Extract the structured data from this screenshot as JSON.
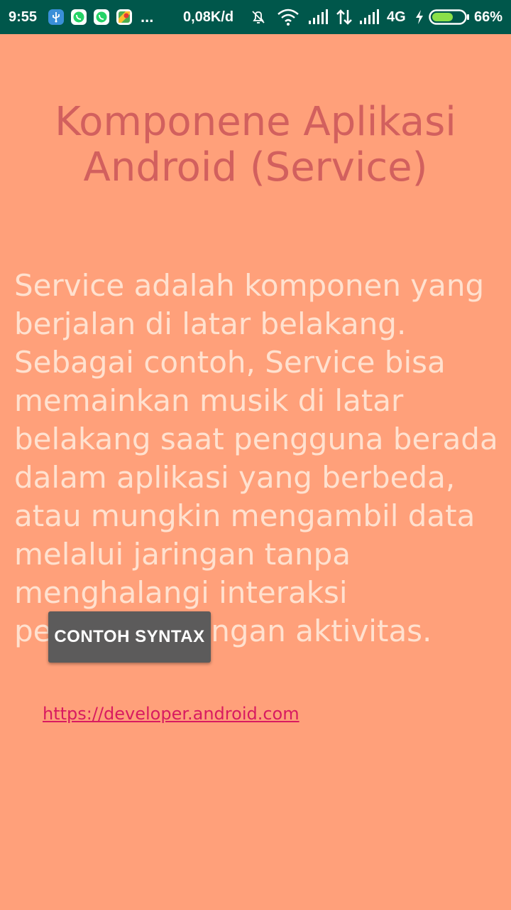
{
  "status_bar": {
    "time": "9:55",
    "more": "...",
    "net_speed": "0,08K/d",
    "network_type": "4G",
    "battery_percent": "66%",
    "battery_level": 0.66,
    "icons": [
      "usb-icon",
      "whatsapp-icon",
      "whatsapp-icon",
      "maps-icon",
      "alarm-off-icon",
      "wifi-icon",
      "signal-icon",
      "data-transfer-icon",
      "signal-icon",
      "charging-icon",
      "battery-icon"
    ],
    "colors": {
      "background": "#00574B"
    }
  },
  "main": {
    "title": "Komponene Aplikasi Android (Service)",
    "description": "Service adalah komponen yang berjalan di latar belakang. Sebagai contoh, Service bisa memainkan musik di latar belakang saat pengguna berada dalam aplikasi yang berbeda, atau mungkin mengambil data melalui jaringan tanpa menghalangi interaksi pengguna dengan aktivitas.",
    "button_label": "CONTOH SYNTAX",
    "link_text": "https://developer.android.com"
  },
  "colors": {
    "background": "#FFA07A",
    "title": "#D2605E",
    "description": "#FFE1CF",
    "button": "#5C5B5B",
    "link": "#D81B60"
  }
}
